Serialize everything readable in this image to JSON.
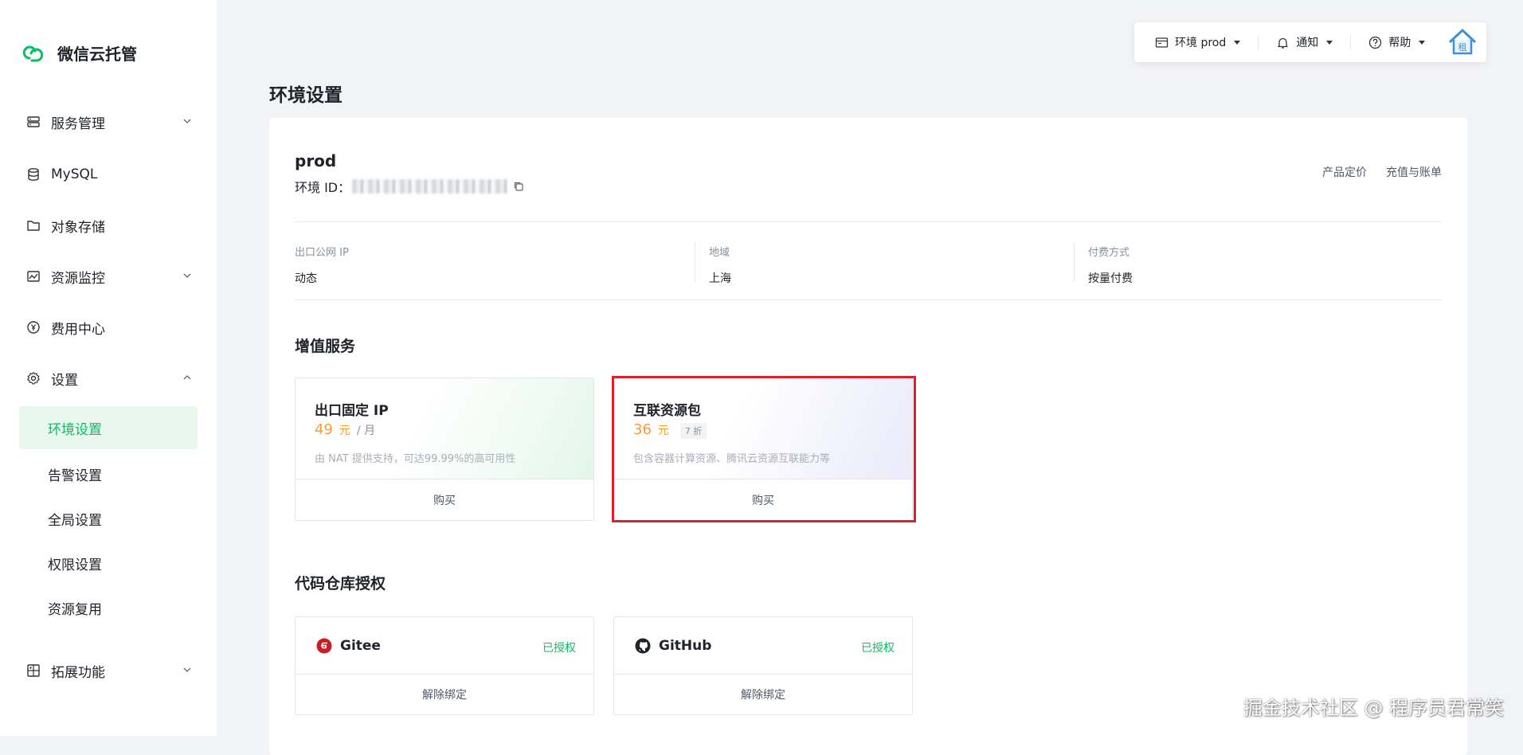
{
  "sidebar": {
    "brand": "微信云托管",
    "items": [
      {
        "label": "服务管理"
      },
      {
        "label": "MySQL"
      },
      {
        "label": "对象存储"
      },
      {
        "label": "资源监控"
      },
      {
        "label": "费用中心"
      },
      {
        "label": "设置"
      },
      {
        "label": "拓展功能"
      }
    ],
    "settings_sub": [
      {
        "label": "环境设置"
      },
      {
        "label": "告警设置"
      },
      {
        "label": "全局设置"
      },
      {
        "label": "权限设置"
      },
      {
        "label": "资源复用"
      }
    ]
  },
  "toolbar": {
    "env": "环境 prod",
    "notify": "通知",
    "help": "帮助",
    "avatar_text": "租"
  },
  "page": {
    "title": "环境设置",
    "env_name": "prod",
    "env_id_label": "环境 ID：",
    "links": [
      "产品定价",
      "充值与账单"
    ],
    "info": [
      {
        "label": "出口公网 IP",
        "value": "动态"
      },
      {
        "label": "地域",
        "value": "上海"
      },
      {
        "label": "付费方式",
        "value": "按量付费"
      }
    ],
    "value_added_title": "增值服务",
    "services": [
      {
        "name": "出口固定 IP",
        "price": "49",
        "unit": "元",
        "per": "/ 月",
        "desc": "由 NAT 提供支持，可达99.99%的高可用性",
        "action": "购买"
      },
      {
        "name": "互联资源包",
        "price": "36",
        "unit": "元",
        "badge": "7 折",
        "desc": "包含容器计算资源、腾讯云资源互联能力等",
        "action": "购买"
      }
    ],
    "repo_title": "代码仓库授权",
    "repos": [
      {
        "name": "Gitee",
        "status": "已授权",
        "action": "解除绑定"
      },
      {
        "name": "GitHub",
        "status": "已授权",
        "action": "解除绑定"
      }
    ]
  },
  "watermark": "掘金技术社区 @ 程序员君常笑",
  "colors": {
    "accent": "#07c160",
    "price": "#ff9a2e",
    "highlight": "#d9222e"
  }
}
